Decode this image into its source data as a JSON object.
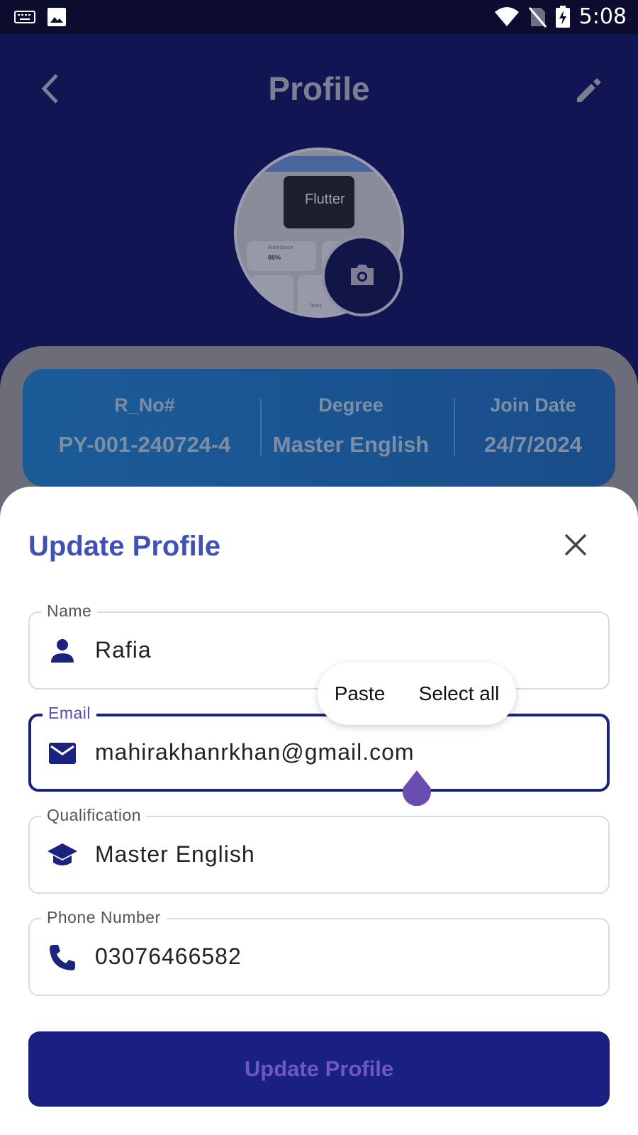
{
  "status_bar": {
    "time": "5:08",
    "icons": [
      "keyboard-icon",
      "image-icon",
      "wifi-icon",
      "no-sim-icon",
      "battery-charging-icon"
    ]
  },
  "header": {
    "title": "Profile",
    "back_icon": "chevron-left-icon",
    "edit_icon": "pencil-icon"
  },
  "avatar": {
    "preview_text": "Flutter",
    "attendance_label": "Attendance",
    "attendance_value": "85%",
    "tasks_label": "Tasks",
    "camera_icon": "camera-icon"
  },
  "info": {
    "r_no_label": "R_No#",
    "r_no_value": "PY-001-240724-4",
    "degree_label": "Degree",
    "degree_value": "Master English",
    "join_label": "Join Date",
    "join_value": "24/7/2024"
  },
  "sheet": {
    "title": "Update Profile",
    "close_icon": "close-icon",
    "fields": [
      {
        "label": "Name",
        "value": "Rafia",
        "icon": "person-icon"
      },
      {
        "label": "Email",
        "value": "mahirakhanrkhan@gmail.com",
        "icon": "mail-icon"
      },
      {
        "label": "Qualification",
        "value": "Master English",
        "icon": "graduation-cap-icon"
      },
      {
        "label": "Phone Number",
        "value": "03076466582",
        "icon": "phone-icon"
      }
    ],
    "context_menu": {
      "paste": "Paste",
      "select_all": "Select all"
    },
    "submit_label": "Update Profile"
  },
  "colors": {
    "accent": "#3f51b5",
    "primary_dark": "#1a237e",
    "cursor": "#6a4fb0"
  }
}
